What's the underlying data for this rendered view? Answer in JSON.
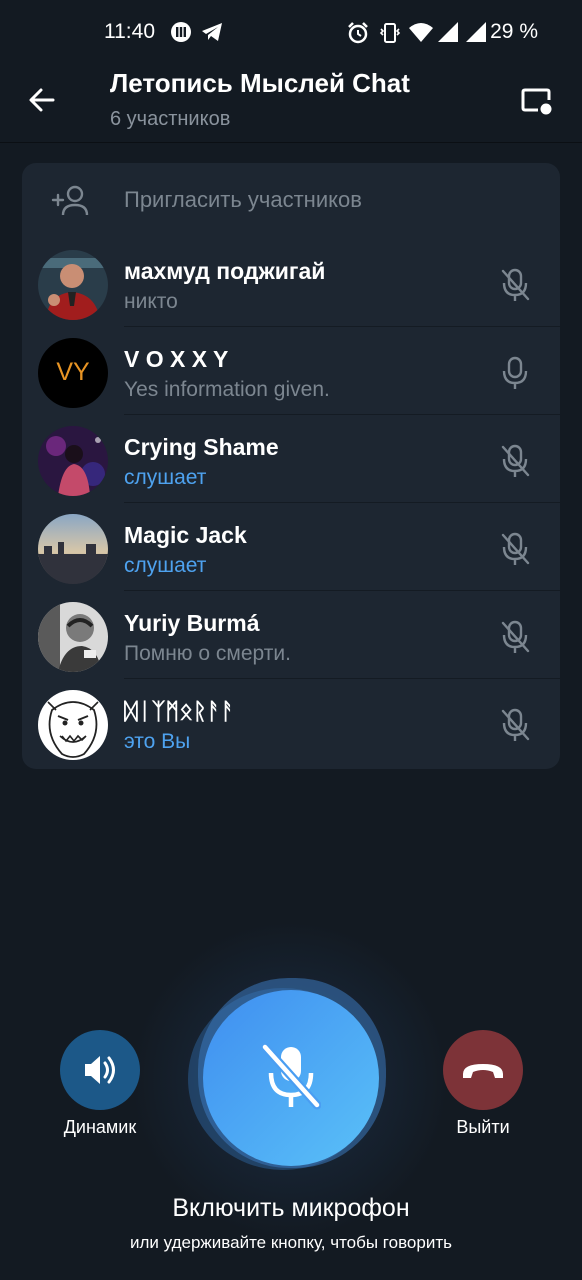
{
  "status_bar": {
    "time": "11:40",
    "battery": "29 %"
  },
  "header": {
    "title": "Летопись Мыслей Chat",
    "subtitle": "6 участников"
  },
  "invite": {
    "label": "Пригласить участников"
  },
  "members": [
    {
      "name": "махмуд поджигай",
      "status": "никто",
      "status_color": "#7c8690",
      "mic": "mic-off-icon"
    },
    {
      "name": "V O X X Y",
      "status": "Yes information given.",
      "status_color": "#7c8690",
      "mic": "mic-icon",
      "avatar_text": "VY"
    },
    {
      "name": "Crying Shame",
      "status": "слушает",
      "status_color": "#4ea2ef",
      "mic": "mic-off-icon"
    },
    {
      "name": "Magic Jack",
      "status": "слушает",
      "status_color": "#4ea2ef",
      "mic": "mic-off-icon"
    },
    {
      "name": "Yuriy Burmá",
      "status": "Помню о смерти.",
      "status_color": "#7c8690",
      "mic": "mic-off-icon"
    },
    {
      "name": "ᛞᛁᛉᛗᛟᚱᚨᚨ",
      "status": "это Вы",
      "status_color": "#4ea2ef",
      "mic": "mic-off-icon"
    }
  ],
  "controls": {
    "speaker_label": "Динамик",
    "leave_label": "Выйти",
    "mic_title": "Включить микрофон",
    "mic_hint": "или удерживайте кнопку, чтобы говорить"
  },
  "colors": {
    "background": "#131a22",
    "panel": "#1d2631",
    "accent_blue": "#4ea2ef",
    "speaker": "#1c5888",
    "leave": "#7d3338"
  }
}
